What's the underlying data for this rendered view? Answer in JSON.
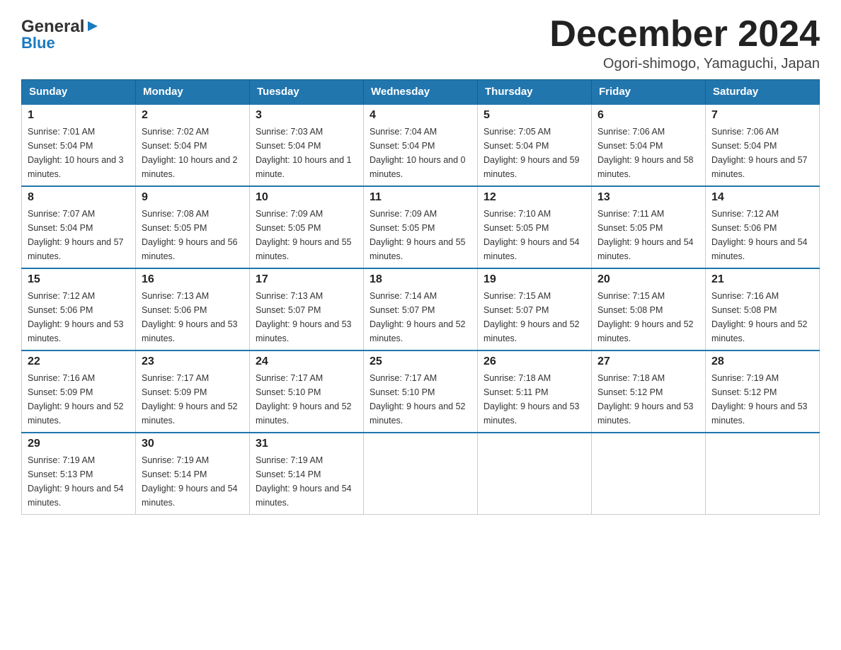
{
  "logo": {
    "general": "General",
    "triangle": "▶",
    "blue": "Blue"
  },
  "header": {
    "month_title": "December 2024",
    "location": "Ogori-shimogo, Yamaguchi, Japan"
  },
  "weekdays": [
    "Sunday",
    "Monday",
    "Tuesday",
    "Wednesday",
    "Thursday",
    "Friday",
    "Saturday"
  ],
  "weeks": [
    [
      {
        "day": "1",
        "sunrise": "7:01 AM",
        "sunset": "5:04 PM",
        "daylight": "10 hours and 3 minutes."
      },
      {
        "day": "2",
        "sunrise": "7:02 AM",
        "sunset": "5:04 PM",
        "daylight": "10 hours and 2 minutes."
      },
      {
        "day": "3",
        "sunrise": "7:03 AM",
        "sunset": "5:04 PM",
        "daylight": "10 hours and 1 minute."
      },
      {
        "day": "4",
        "sunrise": "7:04 AM",
        "sunset": "5:04 PM",
        "daylight": "10 hours and 0 minutes."
      },
      {
        "day": "5",
        "sunrise": "7:05 AM",
        "sunset": "5:04 PM",
        "daylight": "9 hours and 59 minutes."
      },
      {
        "day": "6",
        "sunrise": "7:06 AM",
        "sunset": "5:04 PM",
        "daylight": "9 hours and 58 minutes."
      },
      {
        "day": "7",
        "sunrise": "7:06 AM",
        "sunset": "5:04 PM",
        "daylight": "9 hours and 57 minutes."
      }
    ],
    [
      {
        "day": "8",
        "sunrise": "7:07 AM",
        "sunset": "5:04 PM",
        "daylight": "9 hours and 57 minutes."
      },
      {
        "day": "9",
        "sunrise": "7:08 AM",
        "sunset": "5:05 PM",
        "daylight": "9 hours and 56 minutes."
      },
      {
        "day": "10",
        "sunrise": "7:09 AM",
        "sunset": "5:05 PM",
        "daylight": "9 hours and 55 minutes."
      },
      {
        "day": "11",
        "sunrise": "7:09 AM",
        "sunset": "5:05 PM",
        "daylight": "9 hours and 55 minutes."
      },
      {
        "day": "12",
        "sunrise": "7:10 AM",
        "sunset": "5:05 PM",
        "daylight": "9 hours and 54 minutes."
      },
      {
        "day": "13",
        "sunrise": "7:11 AM",
        "sunset": "5:05 PM",
        "daylight": "9 hours and 54 minutes."
      },
      {
        "day": "14",
        "sunrise": "7:12 AM",
        "sunset": "5:06 PM",
        "daylight": "9 hours and 54 minutes."
      }
    ],
    [
      {
        "day": "15",
        "sunrise": "7:12 AM",
        "sunset": "5:06 PM",
        "daylight": "9 hours and 53 minutes."
      },
      {
        "day": "16",
        "sunrise": "7:13 AM",
        "sunset": "5:06 PM",
        "daylight": "9 hours and 53 minutes."
      },
      {
        "day": "17",
        "sunrise": "7:13 AM",
        "sunset": "5:07 PM",
        "daylight": "9 hours and 53 minutes."
      },
      {
        "day": "18",
        "sunrise": "7:14 AM",
        "sunset": "5:07 PM",
        "daylight": "9 hours and 52 minutes."
      },
      {
        "day": "19",
        "sunrise": "7:15 AM",
        "sunset": "5:07 PM",
        "daylight": "9 hours and 52 minutes."
      },
      {
        "day": "20",
        "sunrise": "7:15 AM",
        "sunset": "5:08 PM",
        "daylight": "9 hours and 52 minutes."
      },
      {
        "day": "21",
        "sunrise": "7:16 AM",
        "sunset": "5:08 PM",
        "daylight": "9 hours and 52 minutes."
      }
    ],
    [
      {
        "day": "22",
        "sunrise": "7:16 AM",
        "sunset": "5:09 PM",
        "daylight": "9 hours and 52 minutes."
      },
      {
        "day": "23",
        "sunrise": "7:17 AM",
        "sunset": "5:09 PM",
        "daylight": "9 hours and 52 minutes."
      },
      {
        "day": "24",
        "sunrise": "7:17 AM",
        "sunset": "5:10 PM",
        "daylight": "9 hours and 52 minutes."
      },
      {
        "day": "25",
        "sunrise": "7:17 AM",
        "sunset": "5:10 PM",
        "daylight": "9 hours and 52 minutes."
      },
      {
        "day": "26",
        "sunrise": "7:18 AM",
        "sunset": "5:11 PM",
        "daylight": "9 hours and 53 minutes."
      },
      {
        "day": "27",
        "sunrise": "7:18 AM",
        "sunset": "5:12 PM",
        "daylight": "9 hours and 53 minutes."
      },
      {
        "day": "28",
        "sunrise": "7:19 AM",
        "sunset": "5:12 PM",
        "daylight": "9 hours and 53 minutes."
      }
    ],
    [
      {
        "day": "29",
        "sunrise": "7:19 AM",
        "sunset": "5:13 PM",
        "daylight": "9 hours and 54 minutes."
      },
      {
        "day": "30",
        "sunrise": "7:19 AM",
        "sunset": "5:14 PM",
        "daylight": "9 hours and 54 minutes."
      },
      {
        "day": "31",
        "sunrise": "7:19 AM",
        "sunset": "5:14 PM",
        "daylight": "9 hours and 54 minutes."
      },
      null,
      null,
      null,
      null
    ]
  ]
}
